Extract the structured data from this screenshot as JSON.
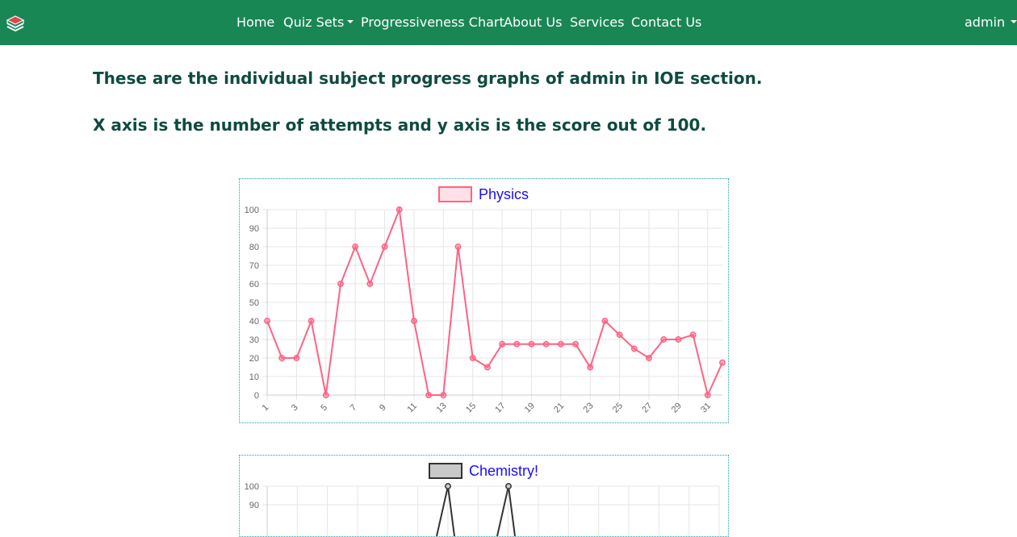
{
  "navbar": {
    "items": [
      {
        "label": "Home"
      },
      {
        "label": "Quiz Sets"
      },
      {
        "label": "Progressiveness Chart"
      },
      {
        "label": "About Us"
      },
      {
        "label": "Services"
      },
      {
        "label": "Contact Us"
      }
    ],
    "user_label": "admin",
    "colors": {
      "background": "#198754",
      "text": "#ffffff"
    }
  },
  "headings": {
    "line1": "These are the individual subject progress graphs of admin in IOE section.",
    "line2": "X axis is the number of attempts and y axis is the score out of 100."
  },
  "chart_data": [
    {
      "type": "line",
      "x": [
        1,
        2,
        3,
        4,
        5,
        6,
        7,
        8,
        9,
        10,
        11,
        12,
        13,
        14,
        15,
        16,
        17,
        18,
        19,
        20,
        21,
        22,
        23,
        24,
        25,
        26,
        27,
        28,
        29,
        30,
        31,
        32
      ],
      "series": [
        {
          "name": "Physics",
          "values": [
            40,
            20,
            20,
            40,
            0,
            60,
            80,
            60,
            80,
            100,
            40,
            0,
            0,
            80,
            20,
            15,
            27.5,
            27.5,
            27.5,
            27.5,
            27.5,
            27.5,
            15,
            40,
            32.5,
            25,
            20,
            30,
            30,
            32.5,
            0,
            17.5
          ],
          "color": "#ff6384"
        }
      ],
      "ylim": [
        0,
        100
      ],
      "y_ticks": [
        0,
        10,
        20,
        30,
        40,
        50,
        60,
        70,
        80,
        90,
        100
      ],
      "x_tick_labels": [
        "1",
        "3",
        "5",
        "7",
        "9",
        "11",
        "13",
        "15",
        "17",
        "19",
        "21",
        "23",
        "25",
        "27",
        "29",
        "31"
      ],
      "grid": true,
      "legend": "top"
    },
    {
      "type": "line",
      "series": [
        {
          "name": "Chemistry!",
          "color": "#333333",
          "peaks_at_100_visible": 2
        }
      ],
      "ylim": [
        0,
        100
      ],
      "y_ticks_visible": [
        100,
        90
      ],
      "grid": true,
      "legend": "top"
    }
  ]
}
